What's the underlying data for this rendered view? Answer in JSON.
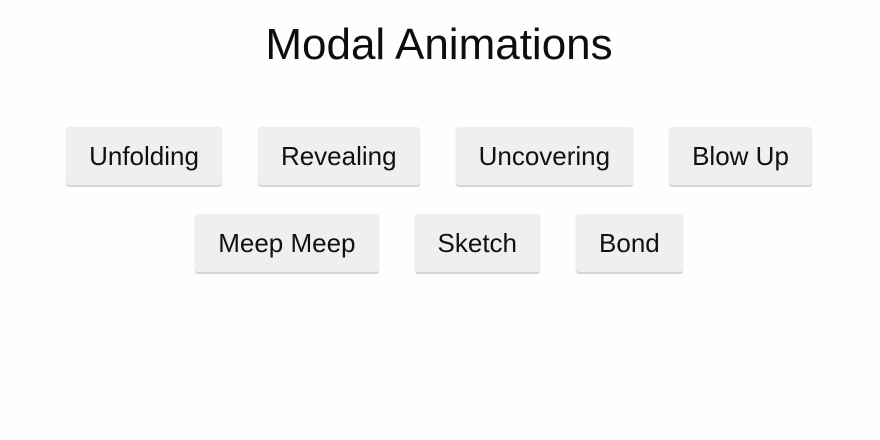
{
  "page": {
    "title": "Modal Animations"
  },
  "buttons": {
    "row1": [
      {
        "label": "Unfolding"
      },
      {
        "label": "Revealing"
      },
      {
        "label": "Uncovering"
      },
      {
        "label": "Blow Up"
      }
    ],
    "row2": [
      {
        "label": "Meep Meep"
      },
      {
        "label": "Sketch"
      },
      {
        "label": "Bond"
      }
    ]
  },
  "colors": {
    "background": "#fefefe",
    "button_background": "#efefef",
    "text": "#111111"
  }
}
